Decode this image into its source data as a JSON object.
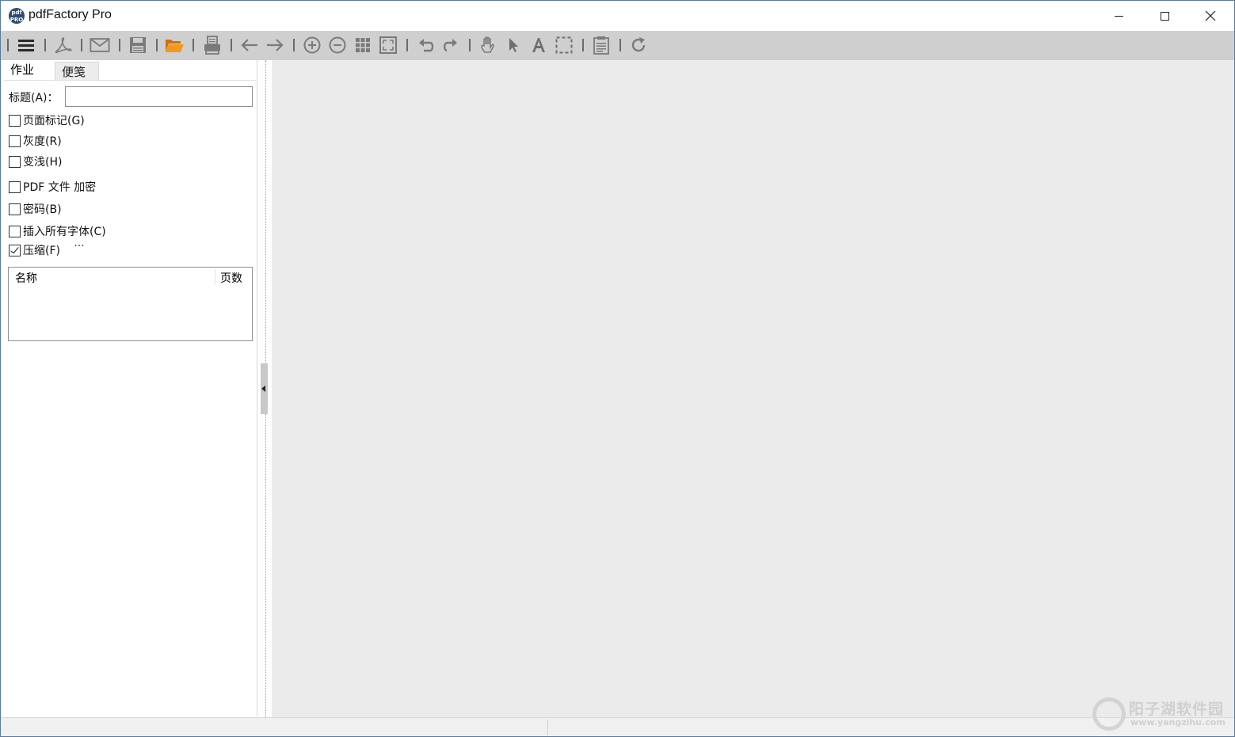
{
  "window": {
    "title": "pdfFactory Pro",
    "logo_text": "pdf PRO"
  },
  "toolbar": {
    "items": [
      {
        "name": "menu-icon"
      },
      {
        "name": "pdf-acrobat-icon"
      },
      {
        "name": "email-icon"
      },
      {
        "name": "save-icon"
      },
      {
        "name": "open-folder-icon"
      },
      {
        "name": "print-icon"
      },
      {
        "name": "arrow-left-icon"
      },
      {
        "name": "arrow-right-icon"
      },
      {
        "name": "zoom-in-icon"
      },
      {
        "name": "zoom-out-icon"
      },
      {
        "name": "thumbnails-grid-icon"
      },
      {
        "name": "fit-page-icon"
      },
      {
        "name": "undo-icon"
      },
      {
        "name": "redo-icon"
      },
      {
        "name": "hand-tool-icon"
      },
      {
        "name": "select-pointer-icon"
      },
      {
        "name": "text-tool-icon"
      },
      {
        "name": "marquee-select-icon"
      },
      {
        "name": "document-info-icon"
      },
      {
        "name": "refresh-icon"
      }
    ],
    "accent_color": "#e8820c",
    "icon_color": "#7a7a7a"
  },
  "tabs": [
    {
      "label": "作业",
      "active": true
    },
    {
      "label": "便笺",
      "active": false
    }
  ],
  "form": {
    "title_label": "标题(A)：",
    "title_value": "",
    "options": [
      {
        "label": "页面标记(G)",
        "checked": false
      },
      {
        "label": "灰度(R)",
        "checked": false
      },
      {
        "label": "变浅(H)",
        "checked": false
      },
      {
        "label": "PDF 文件 加密",
        "checked": false
      },
      {
        "label": "密码(B)",
        "checked": false
      },
      {
        "label": "插入所有字体(C)",
        "checked": false
      },
      {
        "label": "压缩(F)",
        "checked": true
      }
    ],
    "more_label": "···"
  },
  "file_list": {
    "columns": [
      "名称",
      "页数"
    ],
    "rows": []
  },
  "watermark": {
    "text": "阳子湖软件园",
    "url": "www.yangzihu.com"
  }
}
